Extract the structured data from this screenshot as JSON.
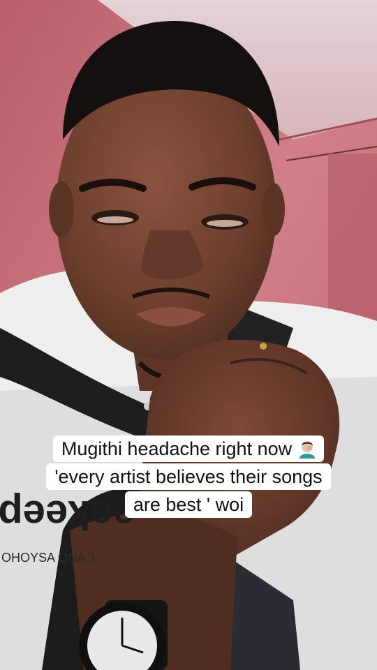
{
  "caption": {
    "lines": [
      "Mugithi headache right now",
      "'every artist believes their songs",
      "are  best ' woi"
    ],
    "emoji_icon": "man-facepalming-emoji"
  },
  "shirt_print": {
    "logo_text": "eekeep",
    "tagline_text": "OHOYSA QNA 3"
  },
  "colors": {
    "wall": "#c9717a",
    "skin": "#6b3f2e",
    "caption_bg": "#ffffff",
    "caption_text": "#111111"
  }
}
